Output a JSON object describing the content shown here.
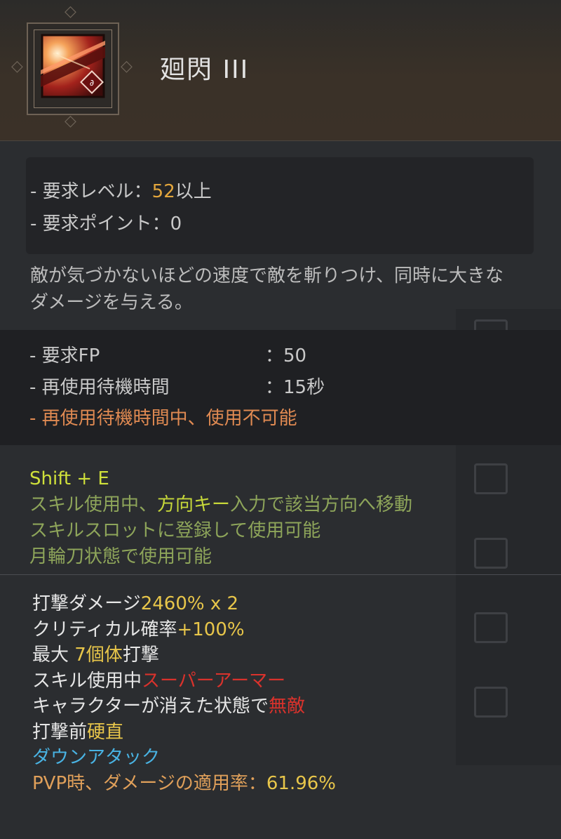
{
  "skill": {
    "name": "廻閃 III",
    "icon": "skill-slash-icon"
  },
  "requirements": {
    "level_label": "- 要求レベル：",
    "level_value": "52",
    "level_suffix": "以上",
    "points_label": "- 要求ポイント：0"
  },
  "description": "敵が気づかないほどの速度で敵を斬りつけ、同時に大きなダメージを与える。",
  "costs": {
    "fp_label": "- 要求FP",
    "fp_value": "：50",
    "cooldown_label": "- 再使用待機時間",
    "cooldown_value": "：15秒",
    "cooldown_warning": "- 再使用待機時間中、使用不可能"
  },
  "controls": {
    "command": "Shift + E",
    "line1_prefix": "スキル使用中、",
    "line1_key": "方向キー",
    "line1_suffix": "入力で該当方向へ移動",
    "line2": "スキルスロットに登録して使用可能",
    "line3": "月輪刀状態で使用可能"
  },
  "stats": {
    "damage_label": "打撃ダメージ",
    "damage_value": "2460% x 2",
    "crit_label": "クリティカル確率",
    "crit_value": "+100%",
    "targets_prefix": "最大 ",
    "targets_value": "7個体",
    "targets_suffix": "打撃",
    "superarmor_prefix": "スキル使用中",
    "superarmor_value": "スーパーアーマー",
    "invinc_prefix": "キャラクターが消えた状態で",
    "invinc_value": "無敵",
    "stiff_prefix": "打撃前",
    "stiff_value": "硬直",
    "downattack": "ダウンアタック",
    "pvp_label": "PVP時、ダメージの適用率：",
    "pvp_value": "61.96%"
  },
  "colors": {
    "accent_orange": "#e3a63c",
    "cooldown_warning": "#e08a52",
    "control_green": "#8ea55a",
    "red_effect": "#d9322c",
    "blue_effect": "#49b3e3"
  }
}
